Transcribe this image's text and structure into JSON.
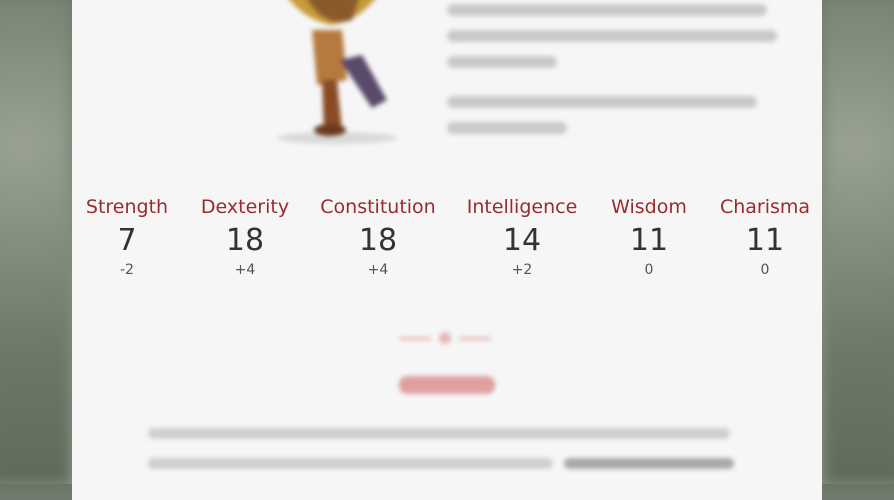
{
  "stats": [
    {
      "label": "Strength",
      "value": "7",
      "modifier": "-2"
    },
    {
      "label": "Dexterity",
      "value": "18",
      "modifier": "+4"
    },
    {
      "label": "Constitution",
      "value": "18",
      "modifier": "+4"
    },
    {
      "label": "Intelligence",
      "value": "14",
      "modifier": "+2"
    },
    {
      "label": "Wisdom",
      "value": "11",
      "modifier": "0"
    },
    {
      "label": "Charisma",
      "value": "11",
      "modifier": "0"
    }
  ],
  "colors": {
    "accent": "#9b2a2a",
    "card_background": "#f6f6f6",
    "value_text": "#333333"
  }
}
